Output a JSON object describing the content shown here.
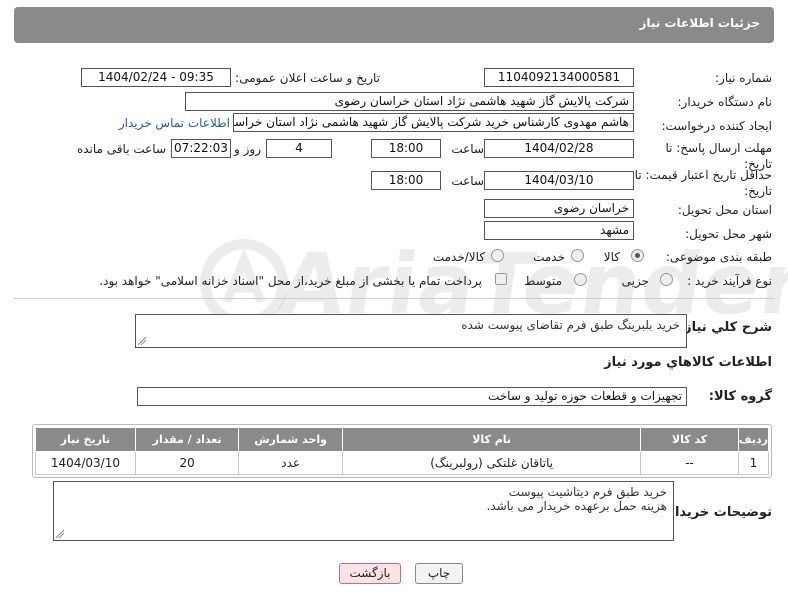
{
  "header": {
    "title": "جزئیات اطلاعات نیاز"
  },
  "labels": {
    "need_number": "شماره نیاز:",
    "announce_datetime": "تاریخ و ساعت اعلان عمومی:",
    "buyer_org": "نام دستگاه خریدار:",
    "requester": "ایجاد کننده درخواست:",
    "reply_deadline": "مهلت ارسال پاسخ: تا تاریخ:",
    "time": "ساعت",
    "days_and": "روز و",
    "remaining": "ساعت باقی مانده",
    "price_validity": "حداقل تاریخ اعتبار قیمت: تا تاریخ:",
    "province": "استان محل تحویل:",
    "city": "شهر محل تحویل:",
    "category": "طبقه بندی موضوعی:",
    "process_type": "نوع فرآیند خرید :",
    "general_desc": "شرح کلي نياز:",
    "goods_info": "اطلاعات کالاهاي مورد نياز",
    "goods_group": "گروه کالا:",
    "buyer_notes": "توضیحات خریدار:"
  },
  "values": {
    "need_number": "1104092134000581",
    "announce_datetime": "1404/02/24 - 09:35",
    "buyer_org": "شرکت پالایش گاز شهید هاشمی نژاد   استان خراسان رضوی",
    "requester": "هاشم مهدوی کارشناس خرید شرکت پالایش گاز شهید هاشمی نژاد   استان خراسان رضوی",
    "reply_date": "1404/02/28",
    "reply_time": "18:00",
    "days": "4",
    "remaining_time": "07:22:03",
    "price_date": "1404/03/10",
    "price_time": "18:00",
    "province": "خراسان رضوی",
    "city": "مشهد",
    "general_desc": "خرید بلبرینگ طبق فرم تقاضای پیوست شده",
    "goods_group": "تجهیزات و قطعات حوزه تولید و ساخت",
    "buyer_notes_line1": "خرید طبق فرم دیتاشیت پیوست",
    "buyer_notes_line2": "هزینه حمل برعهده خریدار می باشد."
  },
  "links": {
    "buyer_contact": "اطلاعات تماس خریدار"
  },
  "category_options": [
    {
      "label": "کالا",
      "checked": true
    },
    {
      "label": "خدمت",
      "checked": false
    },
    {
      "label": "کالا/خدمت",
      "checked": false
    }
  ],
  "process_options": [
    {
      "label": "جزیی",
      "checked": false
    },
    {
      "label": "متوسط",
      "checked": false
    }
  ],
  "payment_note": "پرداخت تمام یا بخشی از مبلغ خرید،از محل \"اسناد خزانه اسلامی\" خواهد بود.",
  "table": {
    "headers": [
      "ردیف",
      "کد کالا",
      "نام کالا",
      "واحد شمارش",
      "تعداد / مقدار",
      "تاریخ نیاز"
    ],
    "rows": [
      [
        "1",
        "--",
        "یاتاقان غلتکی (رولبرینگ)",
        "عدد",
        "20",
        "1404/03/10"
      ]
    ]
  },
  "buttons": {
    "print": "چاپ",
    "back": "بازگشت"
  },
  "watermark": {
    "text": "AriaTender.neT"
  }
}
